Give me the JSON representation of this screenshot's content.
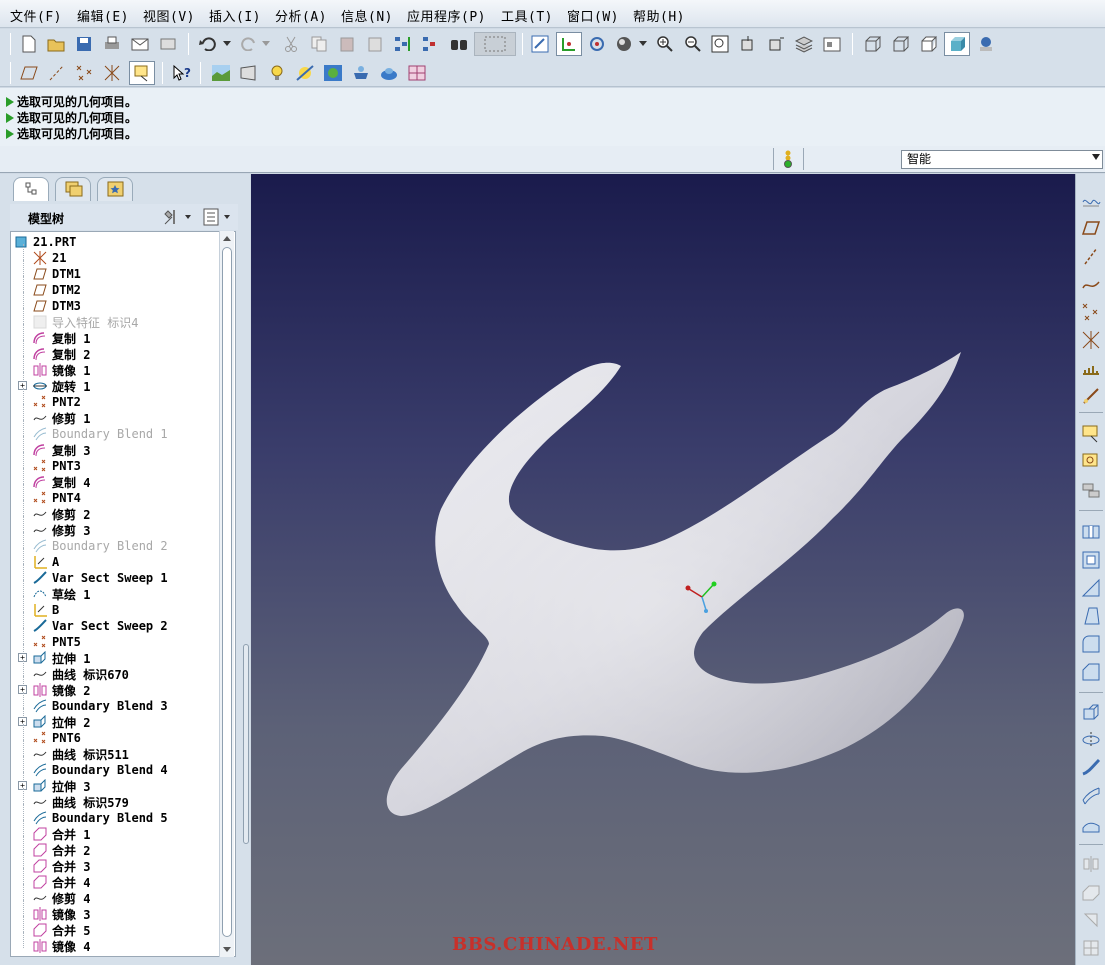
{
  "menu": [
    "文件(F)",
    "编辑(E)",
    "视图(V)",
    "插入(I)",
    "分析(A)",
    "信息(N)",
    "应用程序(P)",
    "工具(T)",
    "窗口(W)",
    "帮助(H)"
  ],
  "messages": [
    "选取可见的几何项目。",
    "选取可见的几何项目。",
    "选取可见的几何项目。"
  ],
  "filter": {
    "value": "智能"
  },
  "model_tree": {
    "title": "模型树",
    "nodes": [
      {
        "label": "21.PRT",
        "icon": "part-icon",
        "grey": false,
        "expand": false
      },
      {
        "label": "21",
        "icon": "csys-icon",
        "grey": false,
        "expand": false
      },
      {
        "label": "DTM1",
        "icon": "datum-plane-icon",
        "grey": false,
        "expand": false
      },
      {
        "label": "DTM2",
        "icon": "datum-plane-icon",
        "grey": false,
        "expand": false
      },
      {
        "label": "DTM3",
        "icon": "datum-plane-icon",
        "grey": false,
        "expand": false
      },
      {
        "label": "导入特征 标识4",
        "icon": "import-icon",
        "grey": true,
        "expand": false
      },
      {
        "label": "复制 1",
        "icon": "copy-icon",
        "grey": false,
        "expand": false
      },
      {
        "label": "复制 2",
        "icon": "copy-icon",
        "grey": false,
        "expand": false
      },
      {
        "label": "镜像 1",
        "icon": "mirror-icon",
        "grey": false,
        "expand": false
      },
      {
        "label": "旋转 1",
        "icon": "revolve-icon",
        "grey": false,
        "expand": true
      },
      {
        "label": "PNT2",
        "icon": "point-icon",
        "grey": false,
        "expand": false
      },
      {
        "label": "修剪 1",
        "icon": "trim-icon",
        "grey": false,
        "expand": false
      },
      {
        "label": "Boundary Blend 1",
        "icon": "boundary-blend-icon",
        "grey": true,
        "expand": false
      },
      {
        "label": "复制 3",
        "icon": "copy-icon",
        "grey": false,
        "expand": false
      },
      {
        "label": "PNT3",
        "icon": "point-icon",
        "grey": false,
        "expand": false
      },
      {
        "label": "复制 4",
        "icon": "copy-icon",
        "grey": false,
        "expand": false
      },
      {
        "label": "PNT4",
        "icon": "point-icon",
        "grey": false,
        "expand": false
      },
      {
        "label": "修剪 2",
        "icon": "trim-icon",
        "grey": false,
        "expand": false
      },
      {
        "label": "修剪 3",
        "icon": "trim-icon",
        "grey": false,
        "expand": false
      },
      {
        "label": "Boundary Blend 2",
        "icon": "boundary-blend-icon",
        "grey": true,
        "expand": false
      },
      {
        "label": "A",
        "icon": "datum-axis-icon",
        "grey": false,
        "expand": false
      },
      {
        "label": "Var Sect Sweep 1",
        "icon": "sweep-icon",
        "grey": false,
        "expand": false
      },
      {
        "label": "草绘 1",
        "icon": "sketch-icon",
        "grey": false,
        "expand": false
      },
      {
        "label": "B",
        "icon": "datum-axis-icon",
        "grey": false,
        "expand": false
      },
      {
        "label": "Var Sect Sweep 2",
        "icon": "sweep-icon",
        "grey": false,
        "expand": false
      },
      {
        "label": "PNT5",
        "icon": "point-icon",
        "grey": false,
        "expand": false
      },
      {
        "label": "拉伸 1",
        "icon": "extrude-icon",
        "grey": false,
        "expand": true
      },
      {
        "label": "曲线 标识670",
        "icon": "curve-icon",
        "grey": false,
        "expand": false
      },
      {
        "label": "镜像 2",
        "icon": "mirror-icon",
        "grey": false,
        "expand": true
      },
      {
        "label": "Boundary Blend 3",
        "icon": "boundary-blend-icon",
        "grey": false,
        "expand": false
      },
      {
        "label": "拉伸 2",
        "icon": "extrude-icon",
        "grey": false,
        "expand": true
      },
      {
        "label": "PNT6",
        "icon": "point-icon",
        "grey": false,
        "expand": false
      },
      {
        "label": "曲线 标识511",
        "icon": "curve-icon",
        "grey": false,
        "expand": false
      },
      {
        "label": "Boundary Blend 4",
        "icon": "boundary-blend-icon",
        "grey": false,
        "expand": false
      },
      {
        "label": "拉伸 3",
        "icon": "extrude-icon",
        "grey": false,
        "expand": true
      },
      {
        "label": "曲线 标识579",
        "icon": "curve-icon",
        "grey": false,
        "expand": false
      },
      {
        "label": "Boundary Blend 5",
        "icon": "boundary-blend-icon",
        "grey": false,
        "expand": false
      },
      {
        "label": "合并 1",
        "icon": "merge-icon",
        "grey": false,
        "expand": false
      },
      {
        "label": "合并 2",
        "icon": "merge-icon",
        "grey": false,
        "expand": false
      },
      {
        "label": "合并 3",
        "icon": "merge-icon",
        "grey": false,
        "expand": false
      },
      {
        "label": "合并 4",
        "icon": "merge-icon",
        "grey": false,
        "expand": false
      },
      {
        "label": "修剪 4",
        "icon": "trim-icon",
        "grey": false,
        "expand": false
      },
      {
        "label": "镜像 3",
        "icon": "mirror-icon",
        "grey": false,
        "expand": false
      },
      {
        "label": "合并 5",
        "icon": "merge-icon",
        "grey": false,
        "expand": false
      },
      {
        "label": "镜像 4",
        "icon": "mirror-icon",
        "grey": false,
        "expand": false
      }
    ]
  },
  "watermark": "BBS.CHINADE.NET",
  "colors": {
    "viewport_top": "#1a1b4c",
    "viewport_bottom": "#6c6f7a",
    "model": "#dcdce2",
    "watermark": "#c8302a",
    "message_arrow": "#2a9d2a"
  }
}
